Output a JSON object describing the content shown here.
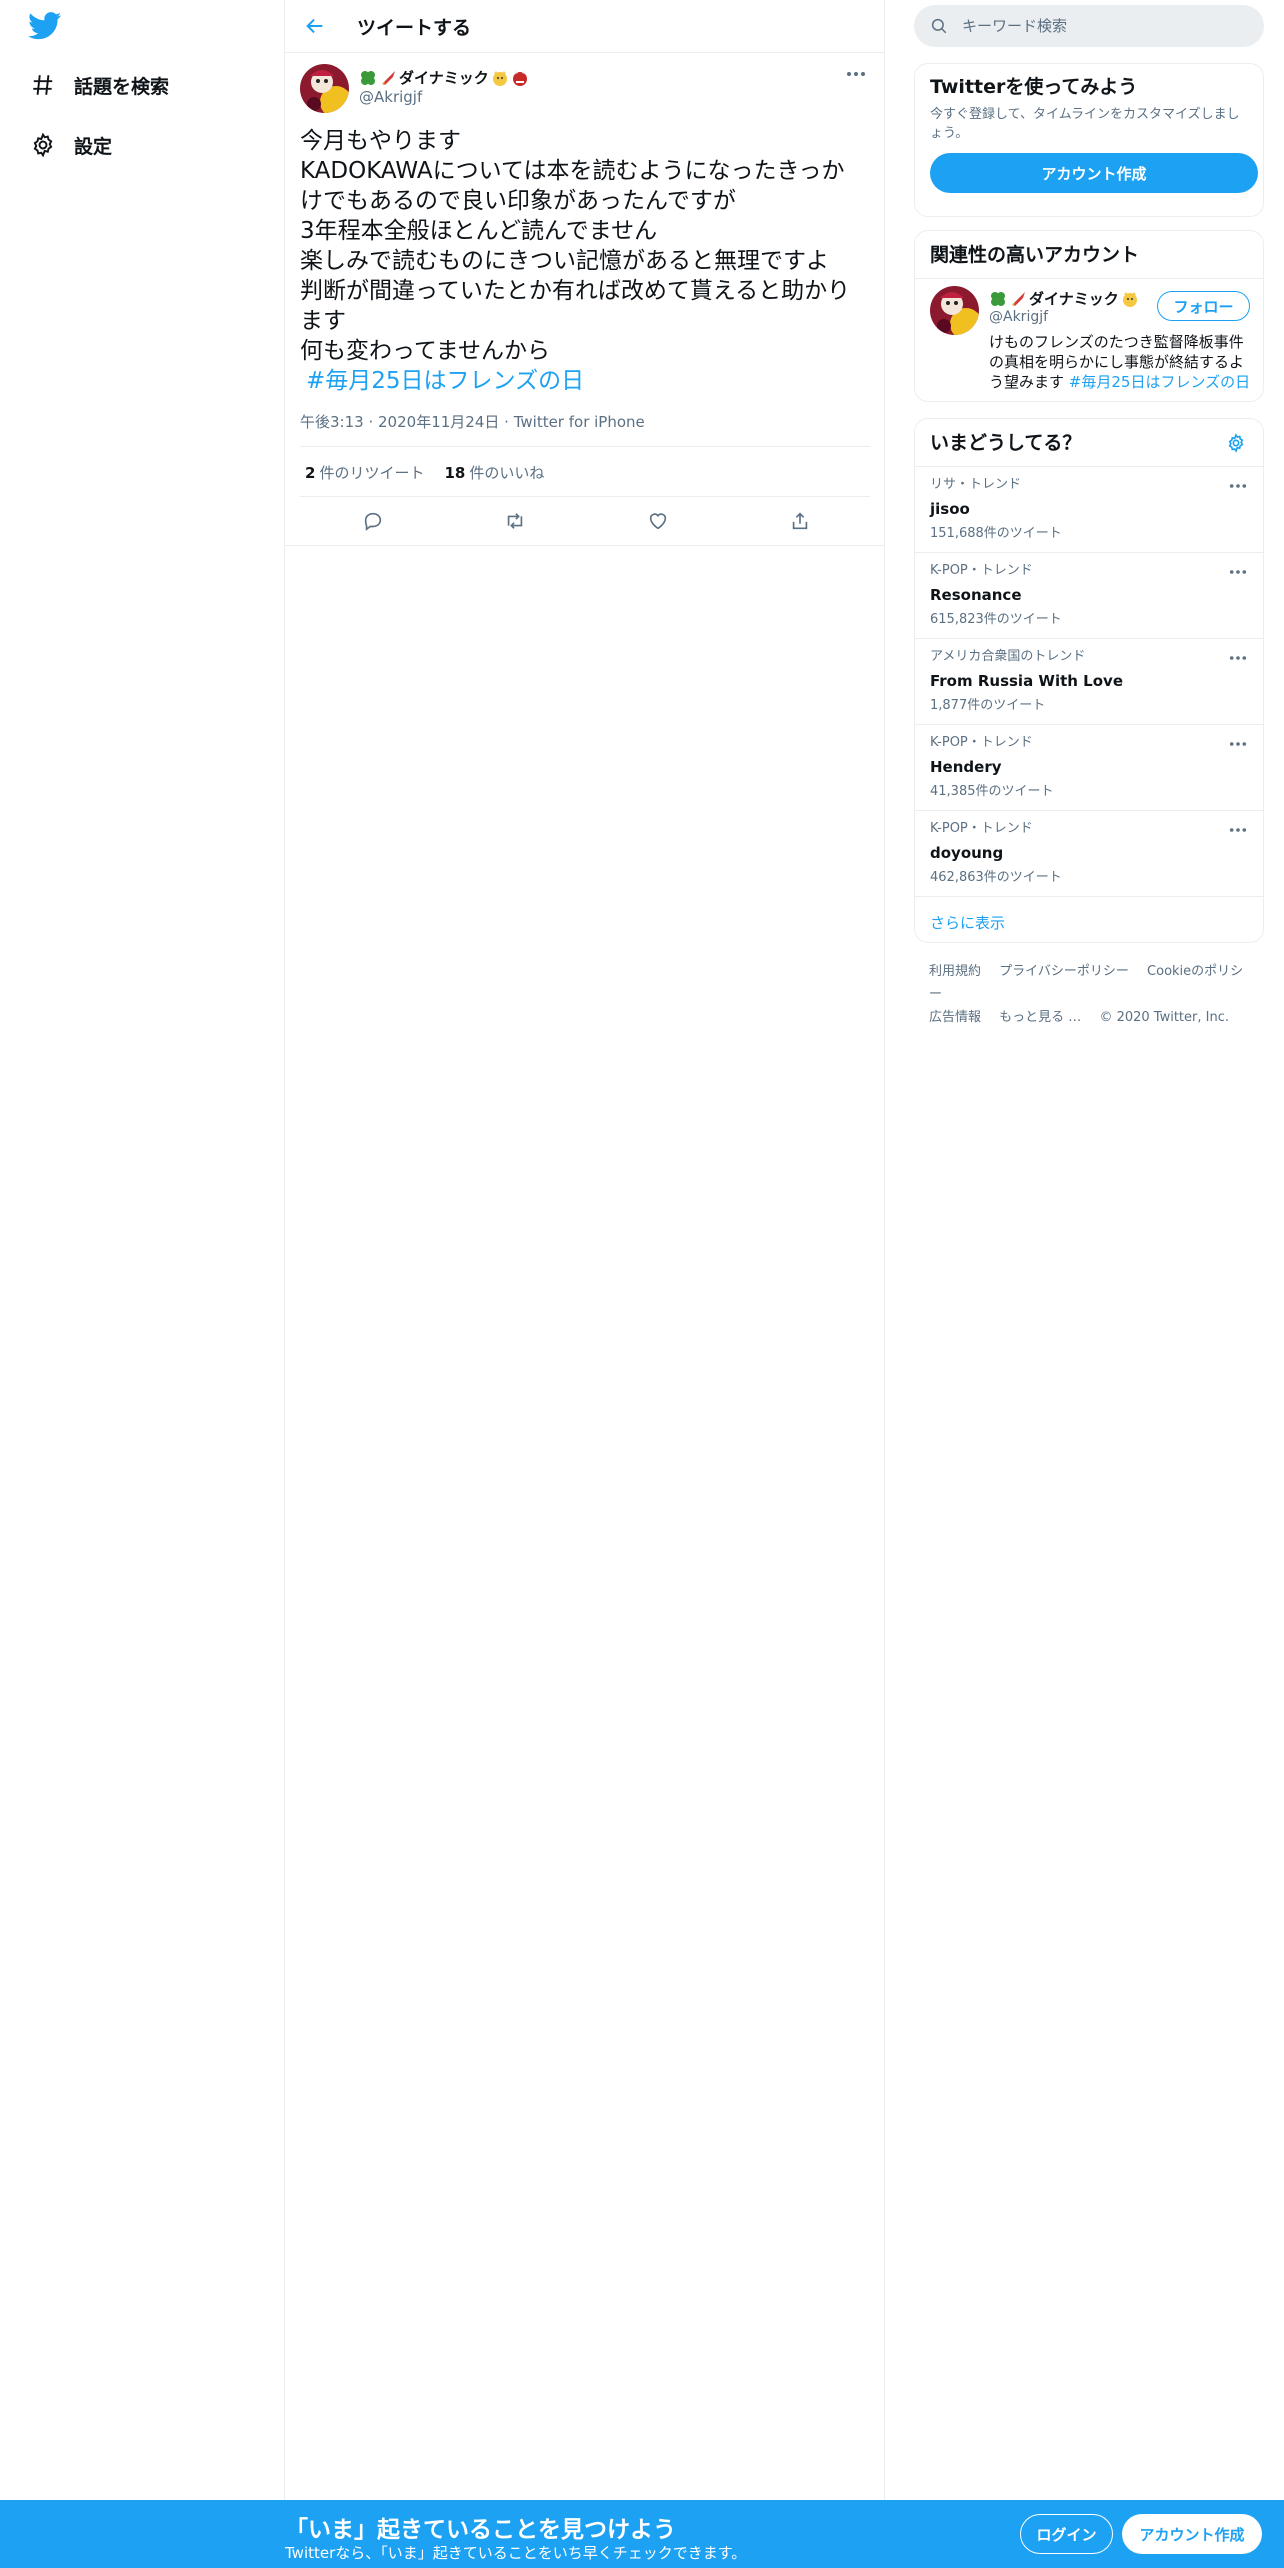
{
  "nav": {
    "explore_label": "話題を検索",
    "settings_label": "設定"
  },
  "header": {
    "title": "ツイートする"
  },
  "tweet": {
    "author_name": "ダイナミック",
    "author_handle": "@Akrigjf",
    "lines": [
      "今月もやります",
      "KADOKAWAについては本を読むようになったきっか",
      "けでもあるので良い印象があったんですが",
      "3年程本全般ほとんど読んでません",
      "楽しみで読むものにきつい記憶があると無理ですよ",
      "判断が間違っていたとか有れば改めて貰えると助かり",
      "ます",
      "何も変わってませんから"
    ],
    "hashtag": "#毎月25日はフレンズの日",
    "time": "午後3:13",
    "date": "2020年11月24日",
    "source": "Twitter for iPhone",
    "retweet_count": "2",
    "retweet_label": "件のリツイート",
    "like_count": "18",
    "like_label": "件のいいね"
  },
  "search": {
    "placeholder": "キーワード検索"
  },
  "signup_panel": {
    "title": "Twitterを使ってみよう",
    "description": "今すぐ登録して、タイムラインをカスタマイズしましょう。",
    "button": "アカウント作成"
  },
  "related": {
    "title": "関連性の高いアカウント",
    "name": "ダイナミック",
    "handle": "@Akrigjf",
    "follow_button": "フォロー",
    "bio": "けものフレンズのたつき監督降板事件の真相を明らかにし事態が終結するよう望みます",
    "bio_hashtag": "#毎月25日はフレンズの日"
  },
  "trends": {
    "title": "いまどうしてる？",
    "items": [
      {
        "context": "リサ・トレンド",
        "name": "jisoo",
        "count": "151,688件のツイート"
      },
      {
        "context": "K-POP・トレンド",
        "name": "Resonance",
        "count": "615,823件のツイート"
      },
      {
        "context": "アメリカ合衆国のトレンド",
        "name": "From Russia With Love",
        "count": "1,877件のツイート"
      },
      {
        "context": "K-POP・トレンド",
        "name": "Hendery",
        "count": "41,385件のツイート"
      },
      {
        "context": "K-POP・トレンド",
        "name": "doyoung",
        "count": "462,863件のツイート"
      }
    ],
    "show_more": "さらに表示"
  },
  "footer": {
    "terms": "利用規約",
    "privacy": "プライバシーポリシー",
    "cookie": "Cookieのポリシー",
    "ads": "広告情報",
    "more": "もっと見る …",
    "copyright": "© 2020 Twitter, Inc."
  },
  "bottombar": {
    "title": "「いま」起きていることを見つけよう",
    "subtitle": "Twitterなら、「いま」起きていることをいち早くチェックできます。",
    "login": "ログイン",
    "signup": "アカウント作成"
  },
  "colors": {
    "accent": "#1da1f2",
    "text": "#0f1419",
    "secondary": "#5b7083",
    "border": "#ebeef0"
  },
  "icons": [
    "twitter-logo-icon",
    "hashtag-icon",
    "gear-icon",
    "back-arrow-icon",
    "more-icon",
    "reply-icon",
    "retweet-icon",
    "like-icon",
    "share-icon",
    "search-icon"
  ]
}
